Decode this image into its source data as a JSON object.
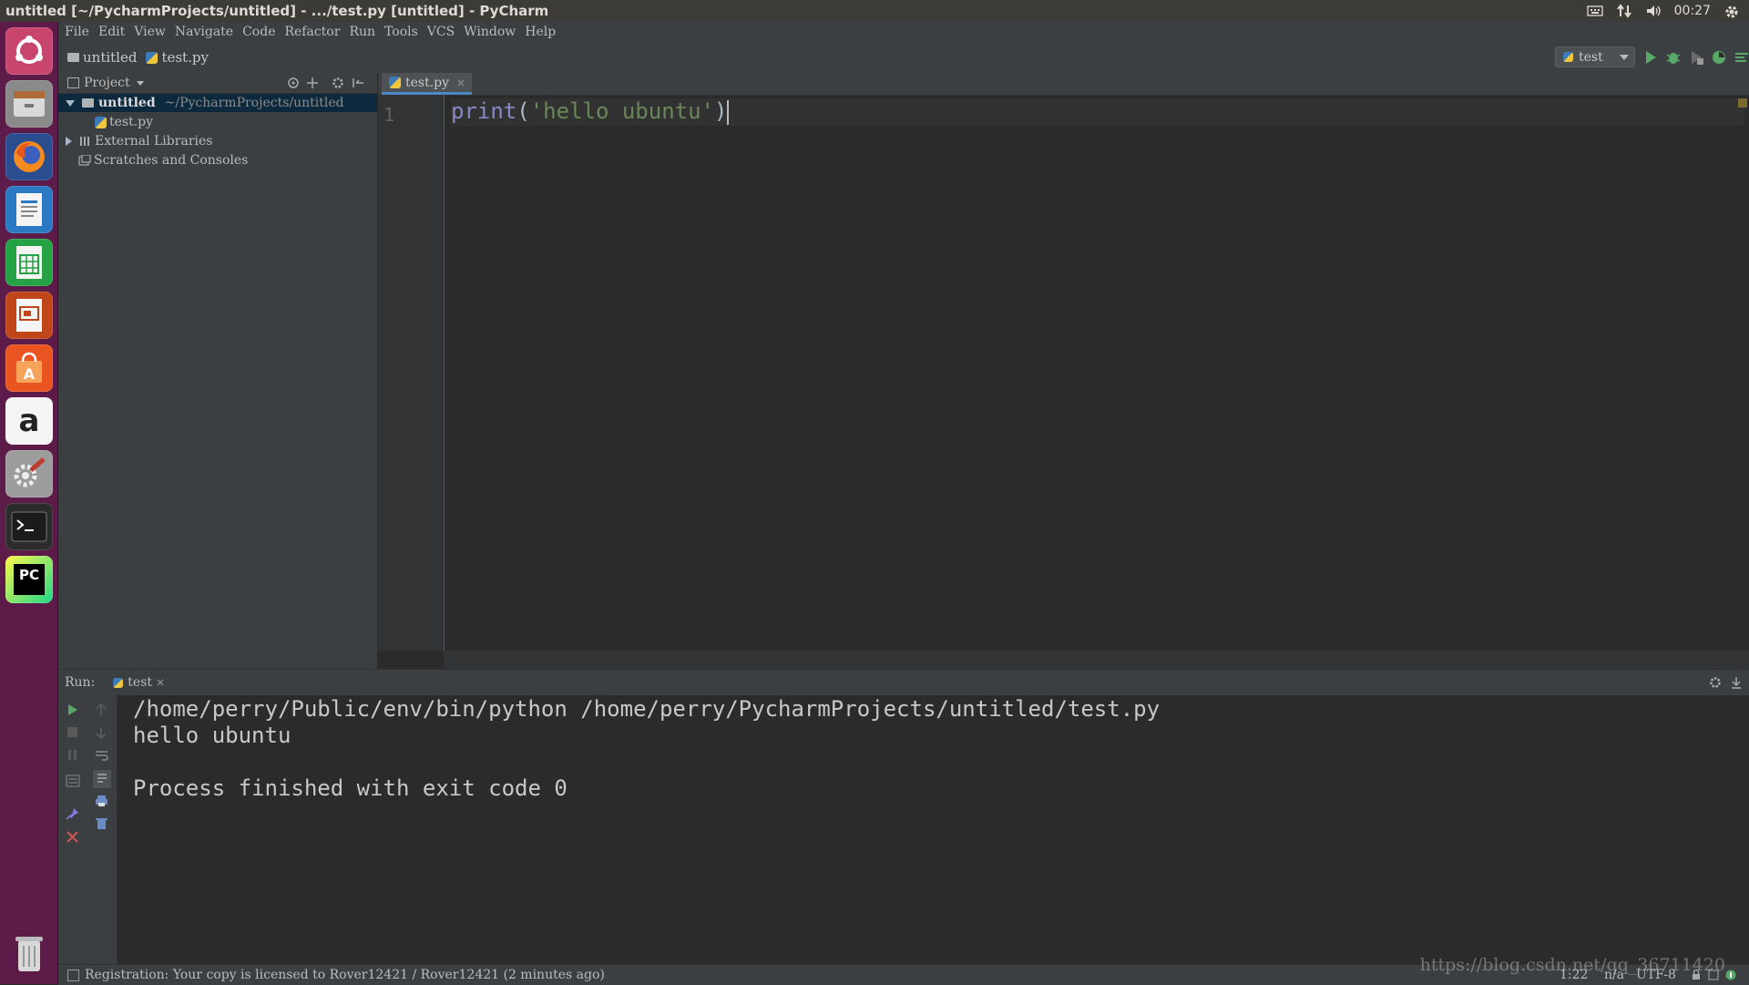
{
  "window": {
    "title": "untitled [~/PycharmProjects/untitled] - .../test.py [untitled] - PyCharm"
  },
  "system_tray": {
    "clock": "00:27",
    "icons": [
      "keyboard-icon",
      "network-icon",
      "volume-icon",
      "settings-gear-icon"
    ]
  },
  "launcher": {
    "items": [
      {
        "name": "ubuntu-dash",
        "color": "#c8466e"
      },
      {
        "name": "files",
        "color": "#7a7a7a"
      },
      {
        "name": "firefox",
        "color": "#e66000"
      },
      {
        "name": "libreoffice-writer",
        "color": "#2b79c2"
      },
      {
        "name": "libreoffice-calc",
        "color": "#25a244"
      },
      {
        "name": "libreoffice-impress",
        "color": "#c0461a"
      },
      {
        "name": "software-center",
        "color": "#e95420"
      },
      {
        "name": "amazon",
        "color": "#f5f5f5"
      },
      {
        "name": "system-settings",
        "color": "#9c9c9c"
      },
      {
        "name": "terminal",
        "color": "#2c2c2c"
      },
      {
        "name": "pycharm",
        "color": "#21d789"
      },
      {
        "name": "trash",
        "color": "#9a9a9a"
      }
    ],
    "amazon_glyph": "a",
    "pycharm_glyph": "PC"
  },
  "menu": {
    "items": [
      "File",
      "Edit",
      "View",
      "Navigate",
      "Code",
      "Refactor",
      "Run",
      "Tools",
      "VCS",
      "Window",
      "Help"
    ]
  },
  "navbar": {
    "project": "untitled",
    "file": "test.py",
    "run_config": "test"
  },
  "project_panel": {
    "title": "Project",
    "root_name": "untitled",
    "root_path": "~/PycharmProjects/untitled",
    "file": "test.py",
    "external_libraries": "External Libraries",
    "scratches": "Scratches and Consoles"
  },
  "editor": {
    "tab_label": "test.py",
    "line_number": "1",
    "code": {
      "fn": "print",
      "open": "(",
      "string": "'hello ubuntu'",
      "close": ")"
    }
  },
  "run_panel": {
    "label": "Run:",
    "tab": "test",
    "output": [
      "/home/perry/Public/env/bin/python /home/perry/PycharmProjects/untitled/test.py",
      "hello ubuntu",
      "",
      "Process finished with exit code 0"
    ]
  },
  "status_bar": {
    "message": "Registration: Your copy is licensed to Rover12421 / Rover12421 (2 minutes ago)",
    "position": "1:22",
    "line_sep": "n/a",
    "encoding": "UTF-8"
  },
  "watermark": "https://blog.csdn.net/qq_36711420",
  "colors": {
    "keyword_fn": "#8888c6",
    "string": "#6a8759",
    "run_green": "#59a869",
    "stop_red": "#c75450",
    "selection": "#0d293e"
  }
}
